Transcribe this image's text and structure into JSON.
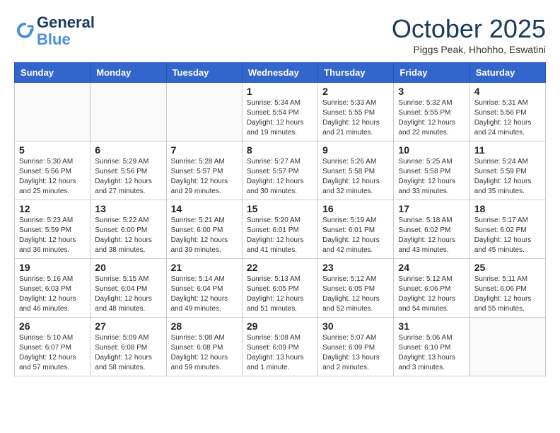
{
  "header": {
    "logo_line1": "General",
    "logo_line2": "Blue",
    "month": "October 2025",
    "location": "Piggs Peak, Hhohho, Eswatini"
  },
  "weekdays": [
    "Sunday",
    "Monday",
    "Tuesday",
    "Wednesday",
    "Thursday",
    "Friday",
    "Saturday"
  ],
  "weeks": [
    [
      {
        "day": "",
        "info": ""
      },
      {
        "day": "",
        "info": ""
      },
      {
        "day": "",
        "info": ""
      },
      {
        "day": "1",
        "info": "Sunrise: 5:34 AM\nSunset: 5:54 PM\nDaylight: 12 hours\nand 19 minutes."
      },
      {
        "day": "2",
        "info": "Sunrise: 5:33 AM\nSunset: 5:55 PM\nDaylight: 12 hours\nand 21 minutes."
      },
      {
        "day": "3",
        "info": "Sunrise: 5:32 AM\nSunset: 5:55 PM\nDaylight: 12 hours\nand 22 minutes."
      },
      {
        "day": "4",
        "info": "Sunrise: 5:31 AM\nSunset: 5:56 PM\nDaylight: 12 hours\nand 24 minutes."
      }
    ],
    [
      {
        "day": "5",
        "info": "Sunrise: 5:30 AM\nSunset: 5:56 PM\nDaylight: 12 hours\nand 25 minutes."
      },
      {
        "day": "6",
        "info": "Sunrise: 5:29 AM\nSunset: 5:56 PM\nDaylight: 12 hours\nand 27 minutes."
      },
      {
        "day": "7",
        "info": "Sunrise: 5:28 AM\nSunset: 5:57 PM\nDaylight: 12 hours\nand 29 minutes."
      },
      {
        "day": "8",
        "info": "Sunrise: 5:27 AM\nSunset: 5:57 PM\nDaylight: 12 hours\nand 30 minutes."
      },
      {
        "day": "9",
        "info": "Sunrise: 5:26 AM\nSunset: 5:58 PM\nDaylight: 12 hours\nand 32 minutes."
      },
      {
        "day": "10",
        "info": "Sunrise: 5:25 AM\nSunset: 5:58 PM\nDaylight: 12 hours\nand 33 minutes."
      },
      {
        "day": "11",
        "info": "Sunrise: 5:24 AM\nSunset: 5:59 PM\nDaylight: 12 hours\nand 35 minutes."
      }
    ],
    [
      {
        "day": "12",
        "info": "Sunrise: 5:23 AM\nSunset: 5:59 PM\nDaylight: 12 hours\nand 36 minutes."
      },
      {
        "day": "13",
        "info": "Sunrise: 5:22 AM\nSunset: 6:00 PM\nDaylight: 12 hours\nand 38 minutes."
      },
      {
        "day": "14",
        "info": "Sunrise: 5:21 AM\nSunset: 6:00 PM\nDaylight: 12 hours\nand 39 minutes."
      },
      {
        "day": "15",
        "info": "Sunrise: 5:20 AM\nSunset: 6:01 PM\nDaylight: 12 hours\nand 41 minutes."
      },
      {
        "day": "16",
        "info": "Sunrise: 5:19 AM\nSunset: 6:01 PM\nDaylight: 12 hours\nand 42 minutes."
      },
      {
        "day": "17",
        "info": "Sunrise: 5:18 AM\nSunset: 6:02 PM\nDaylight: 12 hours\nand 43 minutes."
      },
      {
        "day": "18",
        "info": "Sunrise: 5:17 AM\nSunset: 6:02 PM\nDaylight: 12 hours\nand 45 minutes."
      }
    ],
    [
      {
        "day": "19",
        "info": "Sunrise: 5:16 AM\nSunset: 6:03 PM\nDaylight: 12 hours\nand 46 minutes."
      },
      {
        "day": "20",
        "info": "Sunrise: 5:15 AM\nSunset: 6:04 PM\nDaylight: 12 hours\nand 48 minutes."
      },
      {
        "day": "21",
        "info": "Sunrise: 5:14 AM\nSunset: 6:04 PM\nDaylight: 12 hours\nand 49 minutes."
      },
      {
        "day": "22",
        "info": "Sunrise: 5:13 AM\nSunset: 6:05 PM\nDaylight: 12 hours\nand 51 minutes."
      },
      {
        "day": "23",
        "info": "Sunrise: 5:12 AM\nSunset: 6:05 PM\nDaylight: 12 hours\nand 52 minutes."
      },
      {
        "day": "24",
        "info": "Sunrise: 5:12 AM\nSunset: 6:06 PM\nDaylight: 12 hours\nand 54 minutes."
      },
      {
        "day": "25",
        "info": "Sunrise: 5:11 AM\nSunset: 6:06 PM\nDaylight: 12 hours\nand 55 minutes."
      }
    ],
    [
      {
        "day": "26",
        "info": "Sunrise: 5:10 AM\nSunset: 6:07 PM\nDaylight: 12 hours\nand 57 minutes."
      },
      {
        "day": "27",
        "info": "Sunrise: 5:09 AM\nSunset: 6:08 PM\nDaylight: 12 hours\nand 58 minutes."
      },
      {
        "day": "28",
        "info": "Sunrise: 5:08 AM\nSunset: 6:08 PM\nDaylight: 12 hours\nand 59 minutes."
      },
      {
        "day": "29",
        "info": "Sunrise: 5:08 AM\nSunset: 6:09 PM\nDaylight: 13 hours\nand 1 minute."
      },
      {
        "day": "30",
        "info": "Sunrise: 5:07 AM\nSunset: 6:09 PM\nDaylight: 13 hours\nand 2 minutes."
      },
      {
        "day": "31",
        "info": "Sunrise: 5:06 AM\nSunset: 6:10 PM\nDaylight: 13 hours\nand 3 minutes."
      },
      {
        "day": "",
        "info": ""
      }
    ]
  ]
}
